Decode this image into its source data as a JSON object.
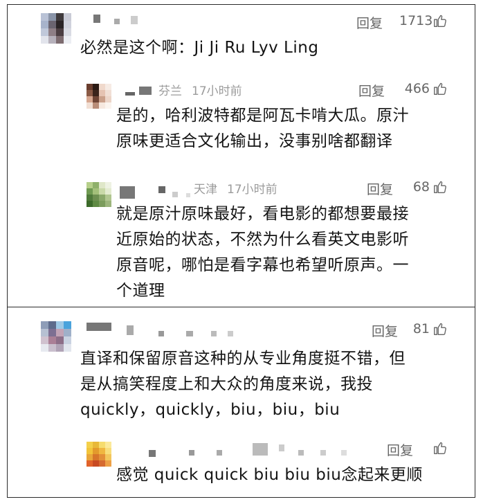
{
  "card1": {
    "comment1": {
      "text": "必然是这个啊：Ji Ji Ru Lyv Ling",
      "reply": "回复",
      "likes": "1713",
      "like_icon": "thumbs-up-icon"
    },
    "reply1": {
      "location": "芬兰",
      "time": "17小时前",
      "reply": "回复",
      "likes": "466",
      "line1": "是的，哈利波特都是阿瓦卡啃大瓜。原汁",
      "line2": "原味更适合文化输出，没事别啥都翻译"
    },
    "reply2": {
      "location": "天津",
      "time": "17小时前",
      "reply": "回复",
      "likes": "68",
      "line1": "就是原汁原味最好，看电影的都想要最接",
      "line2": "近原始的状态，不然为什么看英文电影听",
      "line3": "原音呢，哪怕是看字幕也希望听原声。一",
      "line4": "个道理"
    }
  },
  "card2": {
    "comment1": {
      "reply": "回复",
      "likes": "81",
      "line1": "直译和保留原音这种的从专业角度挺不错，但",
      "line2": "是从搞笑程度上和大众的角度来说，我投",
      "line3": "quickly，quickly，biu，biu，biu"
    },
    "reply1": {
      "reply": "回复",
      "likes": "",
      "line1": "感觉 quick quick biu biu biu念起来更顺"
    }
  },
  "colors": {
    "border": "#2a2a2a",
    "meta_text": "#9b9b9b",
    "action_text": "#666666",
    "body_text": "#141414"
  }
}
